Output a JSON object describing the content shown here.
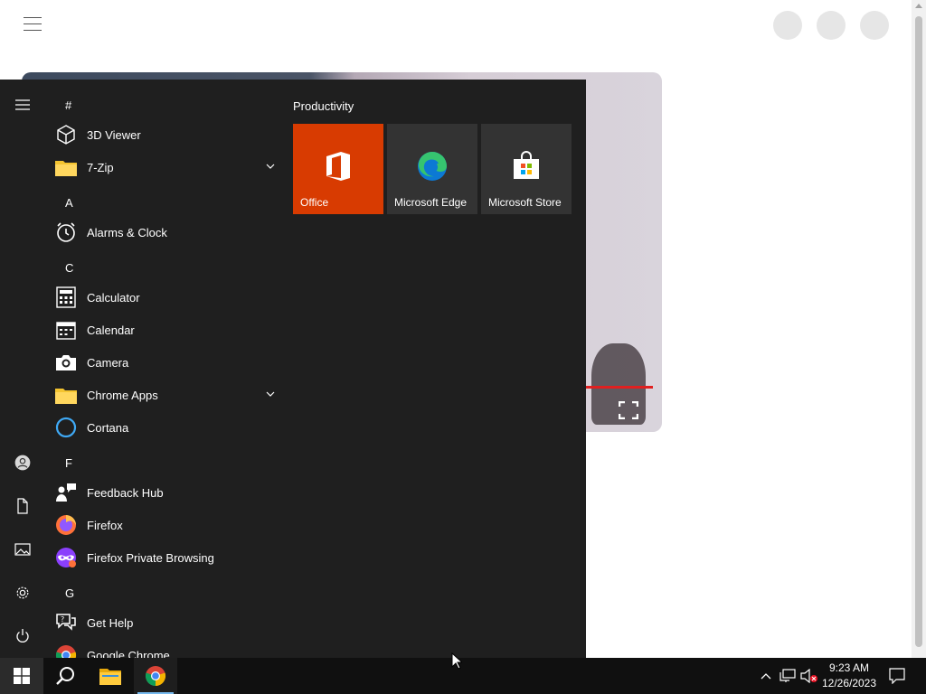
{
  "start_menu": {
    "groups": [
      {
        "letter": "#",
        "apps": [
          {
            "label": "3D Viewer",
            "icon": "cube-icon",
            "expandable": false
          },
          {
            "label": "7-Zip",
            "icon": "folder-icon",
            "expandable": true
          }
        ]
      },
      {
        "letter": "A",
        "apps": [
          {
            "label": "Alarms & Clock",
            "icon": "clock-icon",
            "expandable": false
          }
        ]
      },
      {
        "letter": "C",
        "apps": [
          {
            "label": "Calculator",
            "icon": "calculator-icon",
            "expandable": false
          },
          {
            "label": "Calendar",
            "icon": "calendar-icon",
            "expandable": false
          },
          {
            "label": "Camera",
            "icon": "camera-icon",
            "expandable": false
          },
          {
            "label": "Chrome Apps",
            "icon": "folder-icon",
            "expandable": true
          },
          {
            "label": "Cortana",
            "icon": "cortana-icon",
            "expandable": false
          }
        ]
      },
      {
        "letter": "F",
        "apps": [
          {
            "label": "Feedback Hub",
            "icon": "feedback-icon",
            "expandable": false
          },
          {
            "label": "Firefox",
            "icon": "firefox-icon",
            "expandable": false
          },
          {
            "label": "Firefox Private Browsing",
            "icon": "firefox-private-icon",
            "expandable": false
          }
        ]
      },
      {
        "letter": "G",
        "apps": [
          {
            "label": "Get Help",
            "icon": "help-icon",
            "expandable": false
          },
          {
            "label": "Google Chrome",
            "icon": "chrome-icon",
            "expandable": false
          }
        ]
      }
    ],
    "tiles_group_title": "Productivity",
    "tiles": [
      {
        "label": "Office",
        "icon": "office-icon",
        "color": "#d83b01"
      },
      {
        "label": "Microsoft Edge",
        "icon": "edge-icon",
        "color": "#333333"
      },
      {
        "label": "Microsoft Store",
        "icon": "store-icon",
        "color": "#333333"
      }
    ],
    "rail": [
      "menu-icon",
      "user-icon",
      "documents-icon",
      "pictures-icon",
      "settings-icon",
      "power-icon"
    ]
  },
  "taskbar": {
    "time": "9:23 AM",
    "date": "12/26/2023",
    "pinned": [
      "start-icon",
      "search-icon",
      "file-explorer-icon",
      "chrome-icon"
    ],
    "tray": [
      "chevron-up-icon",
      "network-icon",
      "volume-muted-icon",
      "notifications-icon"
    ]
  },
  "colors": {
    "start_bg": "#1f1f1f",
    "taskbar_bg": "#101010",
    "office_tile": "#d83b01",
    "tile_gray": "#333333"
  }
}
